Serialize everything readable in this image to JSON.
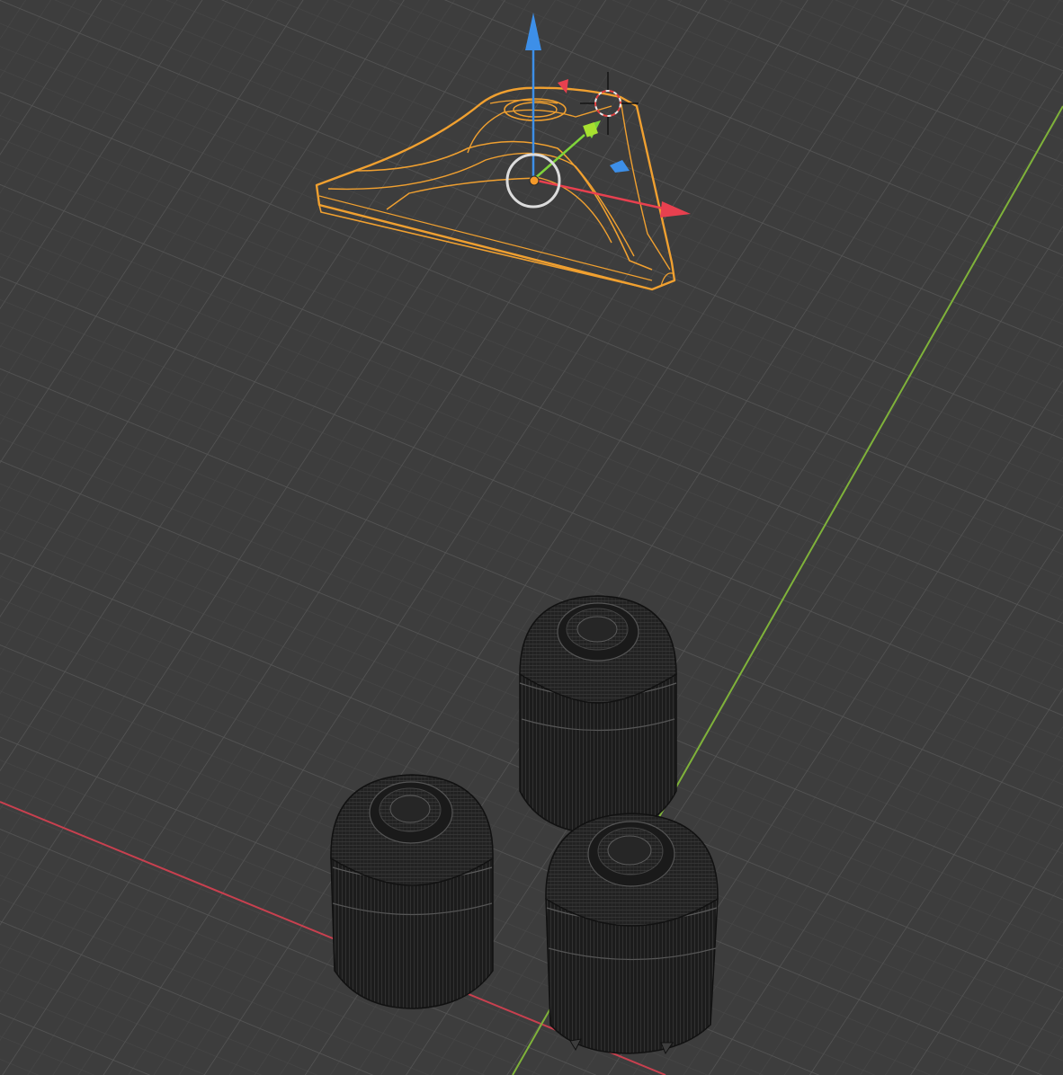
{
  "viewport": {
    "background": "#3d3d3d",
    "grid_minor_color": "#454545",
    "grid_major_color": "#575757",
    "x_axis_color": "#c8404f",
    "y_axis_color": "#7fb23a",
    "selection_outline_color": "#f0a030",
    "object_wire_color": "#0e0e0e"
  },
  "objects": [
    {
      "name": "triangular-bracket",
      "selected": true,
      "display": "wireframe"
    },
    {
      "name": "rubber-bushing-1",
      "selected": false,
      "display": "wireframe"
    },
    {
      "name": "rubber-bushing-2",
      "selected": false,
      "display": "wireframe"
    },
    {
      "name": "rubber-bushing-3",
      "selected": false,
      "display": "wireframe"
    }
  ],
  "gizmo": {
    "type": "move",
    "x_color": "#e8404f",
    "y_color": "#7fd43a",
    "z_color": "#3d8fe8",
    "origin_color": "#f59a2a"
  },
  "cursor_3d": {
    "icon": "3d-cursor-icon",
    "colors": [
      "#e8e8e8",
      "#e04040"
    ]
  }
}
